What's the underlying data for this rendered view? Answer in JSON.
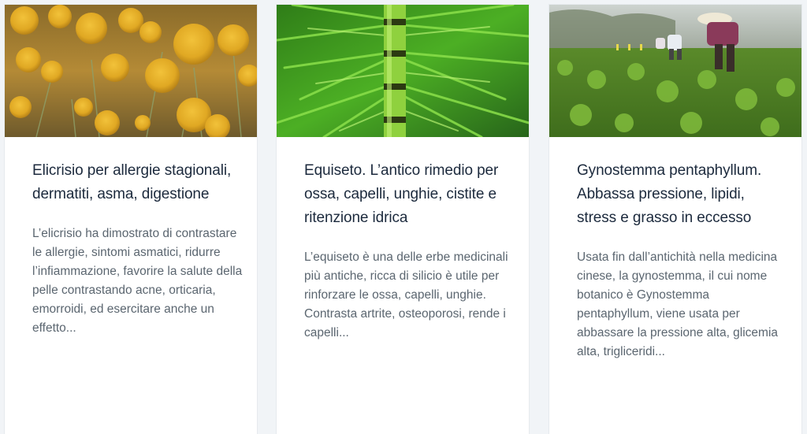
{
  "cards": [
    {
      "image": "helichrysum-flowers-photo",
      "title": "Elicrisio per allergie stagionali, dermatiti, asma, digestione",
      "excerpt": "L’elicrisio ha dimostrato di contrastare le allergie, sintomi asmatici, ridurre l’infiammazione, favorire la salute della pelle contrastando acne, orticaria, emorroidi, ed esercitare anche un effetto..."
    },
    {
      "image": "horsetail-plant-photo",
      "title": "Equiseto. L’antico rimedio per ossa, capelli, unghie, cistite e ritenzione idrica",
      "excerpt": "L’equiseto è una delle erbe medicinali più antiche, ricca di silicio è utile per rinforzare le ossa, capelli, unghie. Contrasta artrite, osteoporosi, rende i capelli..."
    },
    {
      "image": "gynostemma-field-photo",
      "title": "Gynostemma pentaphyllum. Abbassa pressione, lipidi, stress e grasso in eccesso",
      "excerpt": "Usata fin dall’antichità nella medicina cinese, la gynostemma, il cui nome botanico è Gynostemma pentaphyllum, viene usata per abbassare la pressione alta, glicemia alta, trigliceridi..."
    }
  ]
}
